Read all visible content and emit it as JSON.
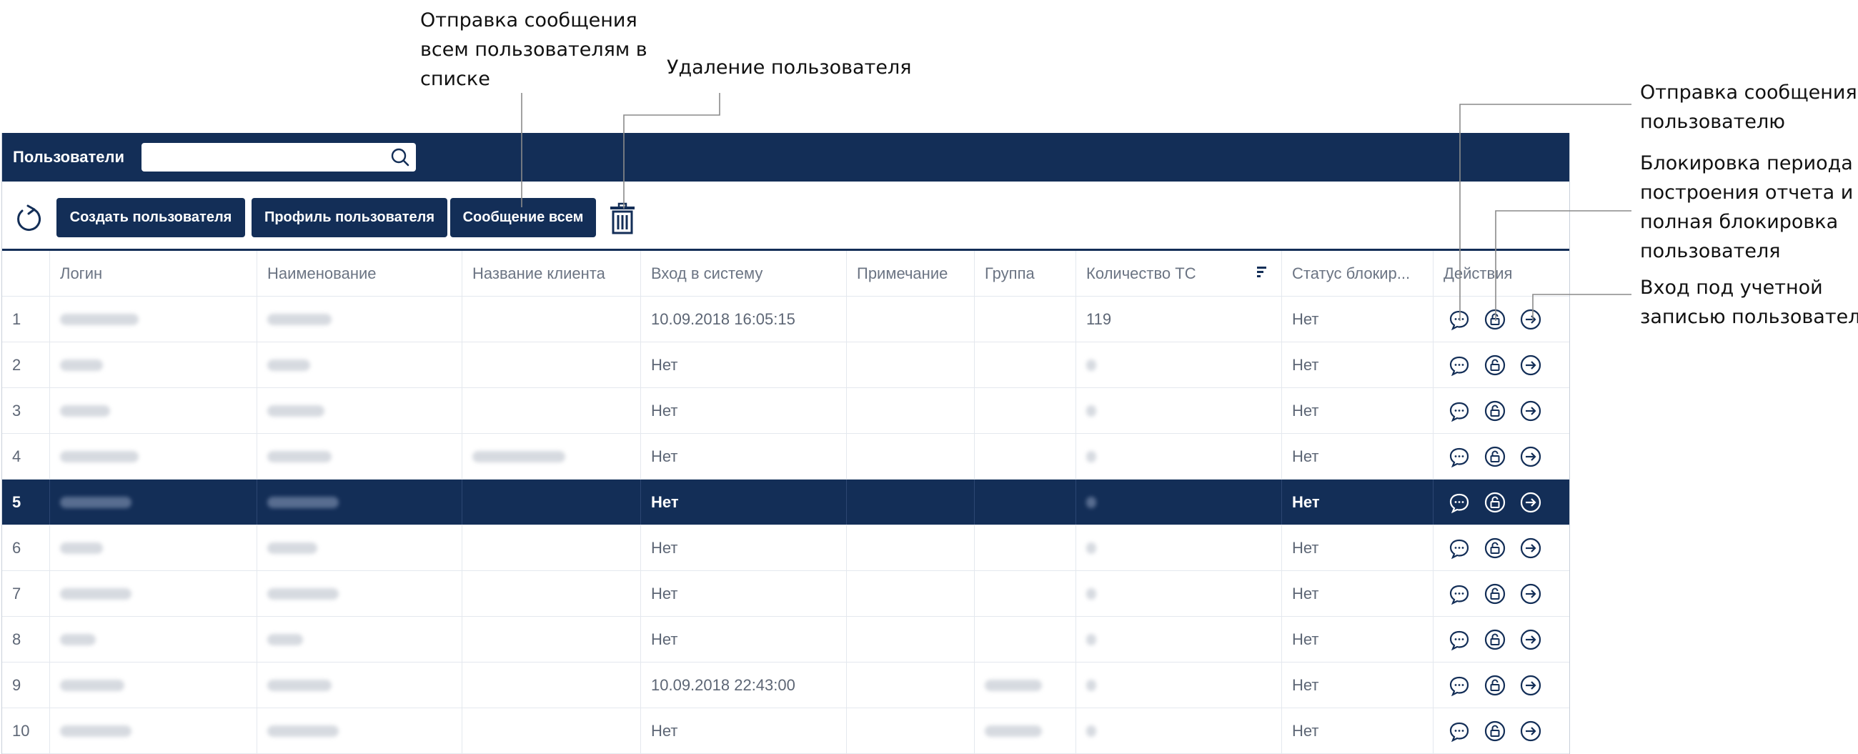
{
  "callouts": {
    "message_all": [
      "Отправка сообщения",
      "всем пользователям в",
      "списке"
    ],
    "delete_user": [
      "Удаление пользователя"
    ],
    "message_user": [
      "Отправка сообщения",
      "пользователю"
    ],
    "block": [
      "Блокировка периода",
      "построения отчета и",
      "полная блокировка",
      "пользователя"
    ],
    "login_as": [
      "Вход под учетной",
      "записью пользователя"
    ]
  },
  "header": {
    "title": "Пользователи",
    "search_placeholder": ""
  },
  "toolbar": {
    "create_user": "Создать пользователя",
    "user_profile": "Профиль пользователя",
    "message_all": "Сообщение всем"
  },
  "table": {
    "columns": [
      "Логин",
      "Наименование",
      "Название клиента",
      "Вход в систему",
      "Примечание",
      "Группа",
      "Количество ТС",
      "Статус блокир...",
      "Действия"
    ],
    "rows": [
      {
        "num": "1",
        "login_in": "10.09.2018 16:05:15",
        "vehicles": "119",
        "block_status": "Нет"
      },
      {
        "num": "2",
        "login_in": "Нет",
        "vehicles": "",
        "block_status": "Нет"
      },
      {
        "num": "3",
        "login_in": "Нет",
        "vehicles": "",
        "block_status": "Нет"
      },
      {
        "num": "4",
        "login_in": "Нет",
        "vehicles": "",
        "block_status": "Нет"
      },
      {
        "num": "5",
        "login_in": "Нет",
        "vehicles": "",
        "block_status": "Нет"
      },
      {
        "num": "6",
        "login_in": "Нет",
        "vehicles": "",
        "block_status": "Нет"
      },
      {
        "num": "7",
        "login_in": "Нет",
        "vehicles": "",
        "block_status": "Нет"
      },
      {
        "num": "8",
        "login_in": "Нет",
        "vehicles": "",
        "block_status": "Нет"
      },
      {
        "num": "9",
        "login_in": "10.09.2018 22:43:00",
        "vehicles": "",
        "block_status": "Нет"
      },
      {
        "num": "10",
        "login_in": "Нет",
        "vehicles": "",
        "block_status": "Нет"
      }
    ],
    "selected_row": "5"
  },
  "colors": {
    "primary": "#132e57",
    "row_border": "#e4e8ee",
    "text_muted": "#5d6675"
  },
  "icons": {
    "search": "search-icon",
    "refresh": "refresh-icon",
    "delete": "trash-icon",
    "message": "message-bubble-icon",
    "lock": "lock-icon",
    "login_as": "arrow-right-circle-icon",
    "sort": "sort-icon"
  }
}
